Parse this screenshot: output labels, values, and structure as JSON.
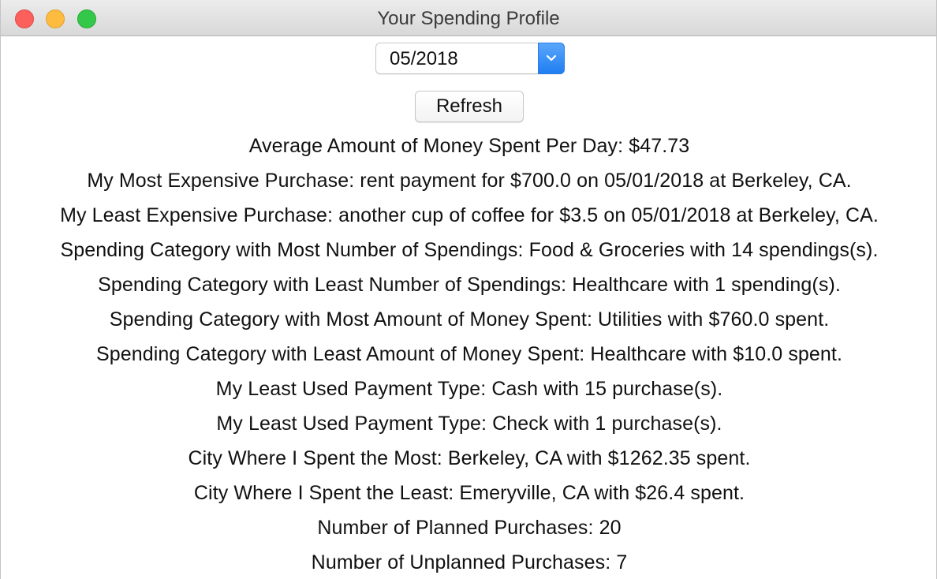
{
  "window": {
    "title": "Your Spending Profile"
  },
  "controls": {
    "month_select_value": "05/2018",
    "refresh_label": "Refresh"
  },
  "stats": {
    "avg_per_day": "Average Amount of Money Spent Per Day: $47.73",
    "most_expensive": "My Most Expensive Purchase: rent payment for $700.0 on 05/01/2018 at Berkeley, CA.",
    "least_expensive": "My Least Expensive Purchase: another cup of coffee for $3.5 on 05/01/2018 at Berkeley, CA.",
    "category_most_count": "Spending Category with Most Number of Spendings: Food & Groceries with 14 spendings(s).",
    "category_least_count": "Spending Category with Least Number of Spendings: Healthcare with 1 spending(s).",
    "category_most_amount": "Spending Category with Most Amount of Money Spent: Utilities with $760.0 spent.",
    "category_least_amount": "Spending Category with Least Amount of Money Spent: Healthcare with $10.0 spent.",
    "payment_type_1": "My Least Used Payment Type: Cash with 15 purchase(s).",
    "payment_type_2": "My Least Used Payment Type: Check with 1 purchase(s).",
    "city_most": "City Where I Spent the Most: Berkeley, CA with $1262.35 spent.",
    "city_least": "City Where I Spent the Least: Emeryville, CA with $26.4 spent.",
    "planned": "Number of Planned Purchases: 20",
    "unplanned": "Number of Unplanned Purchases: 7"
  },
  "colors": {
    "close": "#fc605c",
    "minimize": "#fdbc40",
    "maximize": "#34c84a",
    "select_accent": "#1f7ef2"
  },
  "icons": {
    "select_arrow": "chevron-down-icon"
  }
}
